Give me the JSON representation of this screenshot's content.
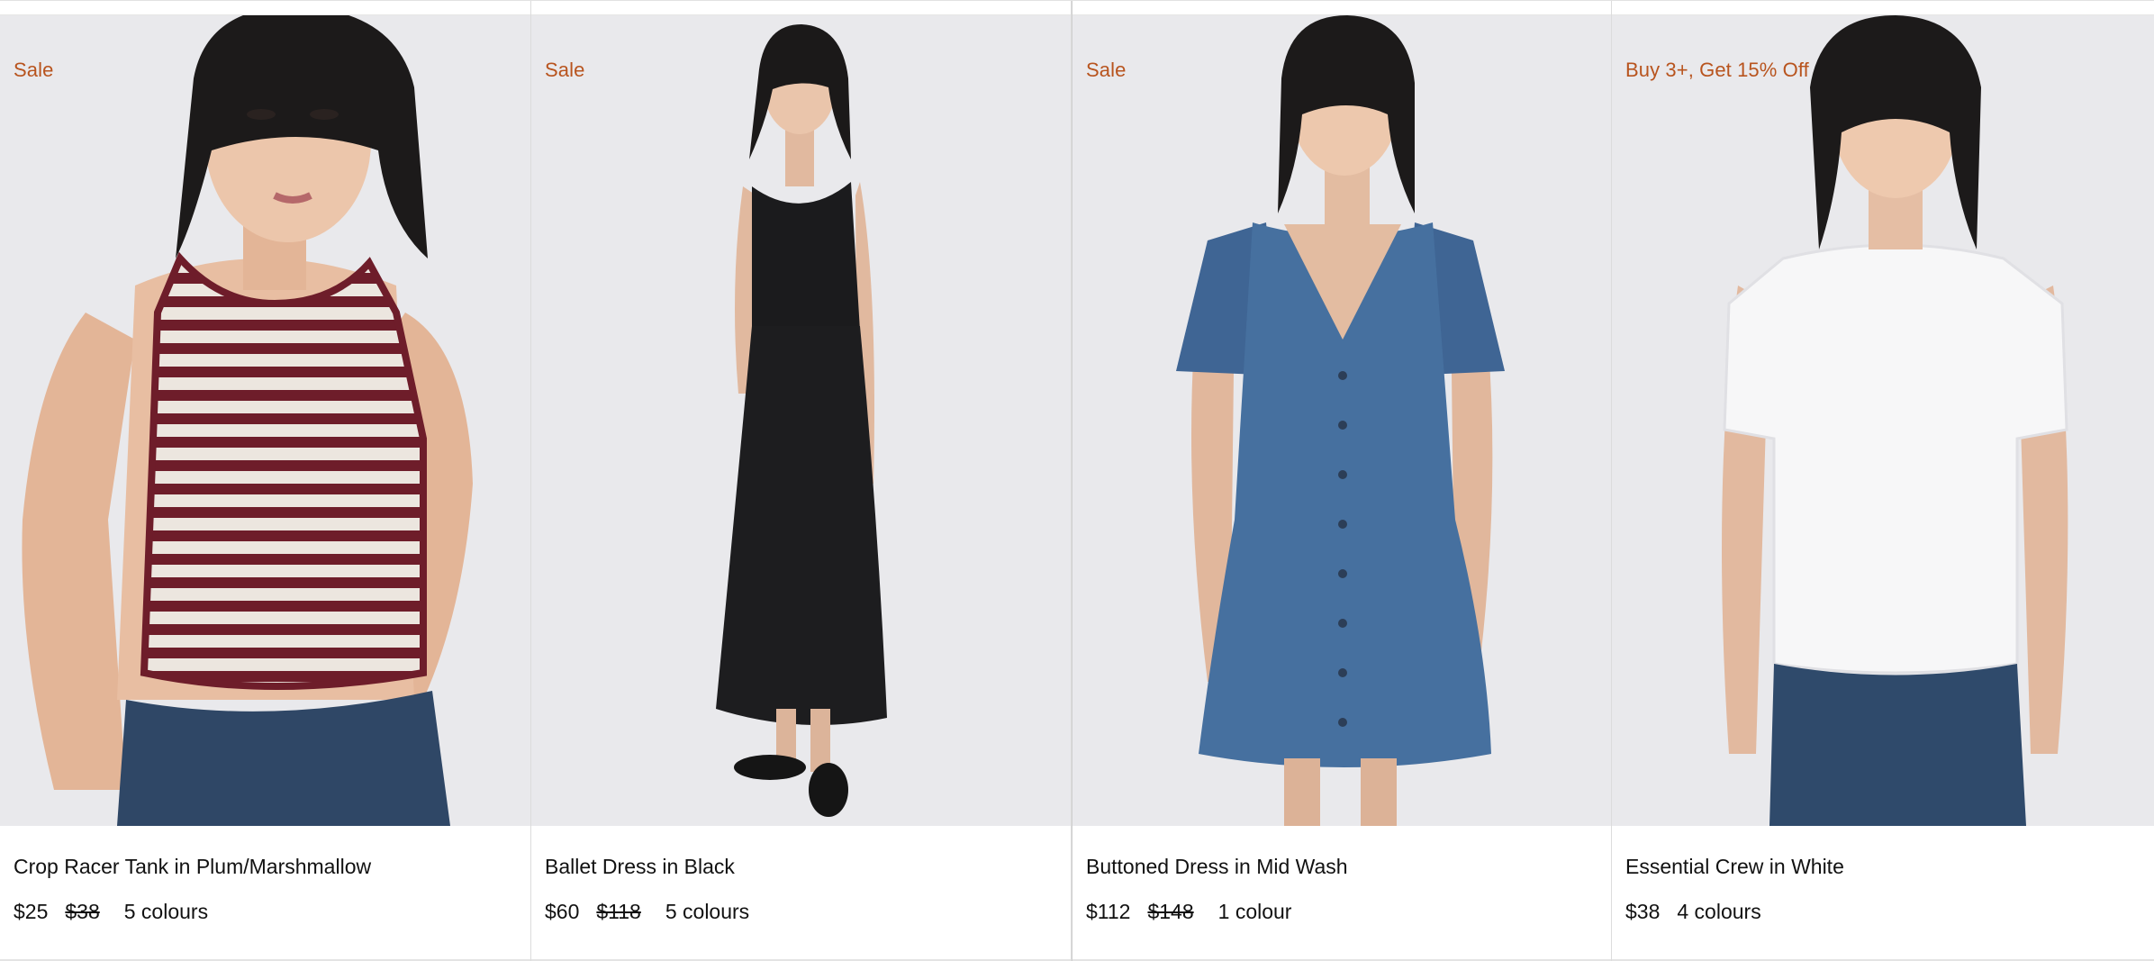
{
  "products": [
    {
      "badge": "Sale",
      "title": "Crop Racer Tank in Plum/Marshmallow",
      "price": "$25",
      "original_price": "$38",
      "colours": "5 colours"
    },
    {
      "badge": "Sale",
      "title": "Ballet Dress in Black",
      "price": "$60",
      "original_price": "$118",
      "colours": "5 colours"
    },
    {
      "badge": "Sale",
      "title": "Buttoned Dress in Mid Wash",
      "price": "$112",
      "original_price": "$148",
      "colours": "1 colour"
    },
    {
      "badge": "Buy 3+, Get 15% Off",
      "title": "Essential Crew in White",
      "price": "$38",
      "original_price": "",
      "colours": "4 colours"
    }
  ],
  "colors": {
    "badge": "#b8541e",
    "image_background": "#e9e9ec",
    "text": "#111111"
  }
}
